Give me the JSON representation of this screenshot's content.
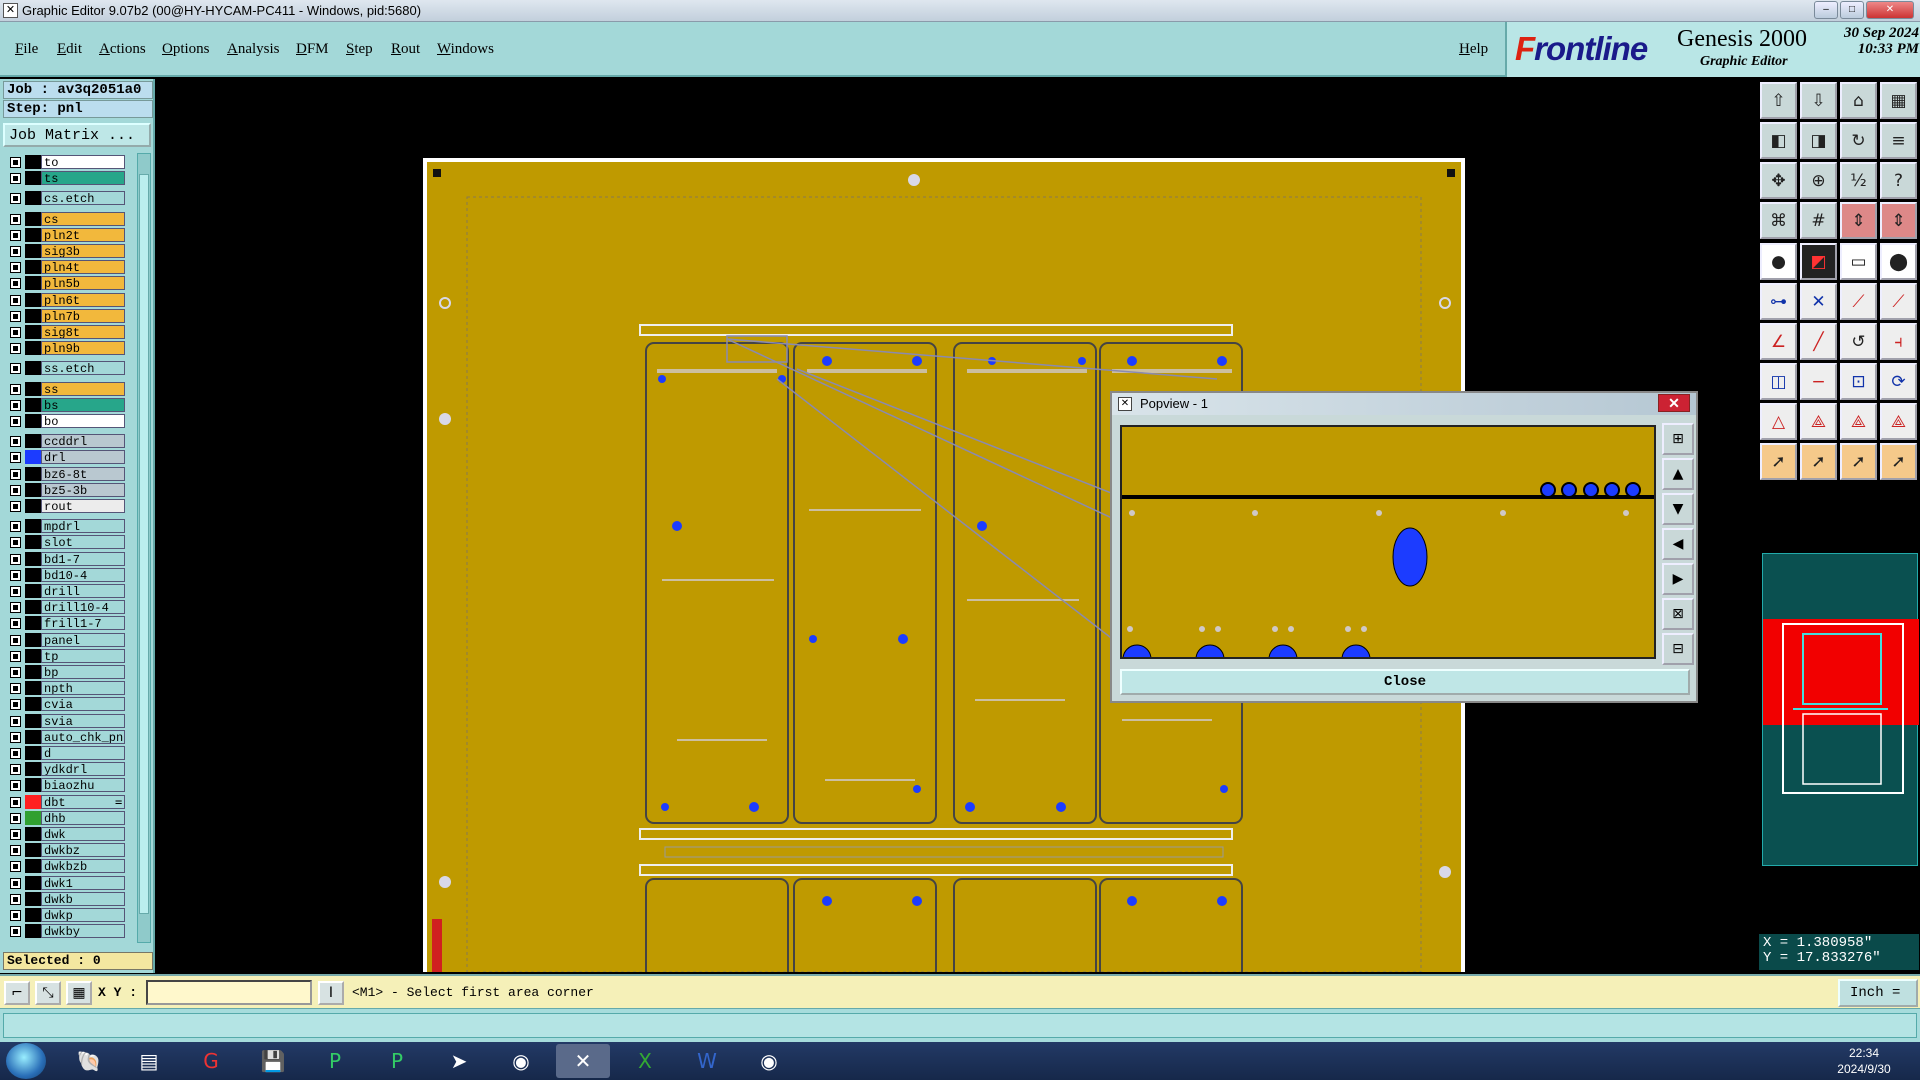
{
  "window": {
    "title": "Graphic Editor 9.07b2 (00@HY-HYCAM-PC411 - Windows, pid:5680)",
    "min": "–",
    "max": "□",
    "close": "✕"
  },
  "menu": {
    "items": [
      "File",
      "Edit",
      "Actions",
      "Options",
      "Analysis",
      "DFM",
      "Step",
      "Rout",
      "Windows"
    ],
    "help": "Help"
  },
  "brand": {
    "logo_f": "F",
    "logo_rest": "rontline",
    "product": "Genesis 2000",
    "subtitle": "Graphic Editor",
    "date": "30 Sep 2024",
    "time": "10:33 PM"
  },
  "job": {
    "job_line": "Job : av3q2051a0",
    "step_line": "Step: pnl",
    "matrix_button": "Job Matrix ..."
  },
  "layers": [
    {
      "name": "to",
      "bg": "#ffffff",
      "sw": "#000000"
    },
    {
      "name": "ts",
      "bg": "#27a68a",
      "sw": "#000000"
    },
    {
      "name": "cs.etch",
      "bg": "#a3d8d8",
      "sw": "#000000",
      "gap": true
    },
    {
      "name": "cs",
      "bg": "#f2b83c",
      "sw": "#000000",
      "gap": true
    },
    {
      "name": "pln2t",
      "bg": "#f2b83c",
      "sw": "#000000"
    },
    {
      "name": "sig3b",
      "bg": "#f2b83c",
      "sw": "#000000"
    },
    {
      "name": "pln4t",
      "bg": "#f2b83c",
      "sw": "#000000"
    },
    {
      "name": "pln5b",
      "bg": "#f2b83c",
      "sw": "#000000"
    },
    {
      "name": "pln6t",
      "bg": "#f2b83c",
      "sw": "#000000"
    },
    {
      "name": "pln7b",
      "bg": "#f2b83c",
      "sw": "#000000"
    },
    {
      "name": "sig8t",
      "bg": "#f2b83c",
      "sw": "#000000"
    },
    {
      "name": "pln9b",
      "bg": "#f2b83c",
      "sw": "#000000"
    },
    {
      "name": "ss.etch",
      "bg": "#a3d8d8",
      "sw": "#000000",
      "gap": true
    },
    {
      "name": "ss",
      "bg": "#f2b83c",
      "sw": "#000000",
      "gap": true
    },
    {
      "name": "bs",
      "bg": "#27a68a",
      "sw": "#000000"
    },
    {
      "name": "bo",
      "bg": "#ffffff",
      "sw": "#000000"
    },
    {
      "name": "ccddrl",
      "bg": "#b9c8d0",
      "sw": "#000000",
      "gap": true
    },
    {
      "name": "drl",
      "bg": "#b9c8d0",
      "sw": "#1c3cff"
    },
    {
      "name": "bz6-8t",
      "bg": "#b9c8d0",
      "sw": "#000000"
    },
    {
      "name": "bz5-3b",
      "bg": "#b9c8d0",
      "sw": "#000000"
    },
    {
      "name": "rout",
      "bg": "#ececec",
      "sw": "#000000"
    },
    {
      "name": "mpdrl",
      "bg": "#a3d8d8",
      "sw": "#000000",
      "gap": true
    },
    {
      "name": "slot",
      "bg": "#a3d8d8",
      "sw": "#000000"
    },
    {
      "name": "bd1-7",
      "bg": "#a3d8d8",
      "sw": "#000000"
    },
    {
      "name": "bd10-4",
      "bg": "#a3d8d8",
      "sw": "#000000"
    },
    {
      "name": "drill",
      "bg": "#a3d8d8",
      "sw": "#000000"
    },
    {
      "name": "drill10-4",
      "bg": "#a3d8d8",
      "sw": "#000000"
    },
    {
      "name": "frill1-7",
      "bg": "#a3d8d8",
      "sw": "#000000"
    },
    {
      "name": "panel",
      "bg": "#a3d8d8",
      "sw": "#000000"
    },
    {
      "name": "tp",
      "bg": "#a3d8d8",
      "sw": "#000000"
    },
    {
      "name": "bp",
      "bg": "#a3d8d8",
      "sw": "#000000"
    },
    {
      "name": "npth",
      "bg": "#a3d8d8",
      "sw": "#000000"
    },
    {
      "name": "cvia",
      "bg": "#a3d8d8",
      "sw": "#000000"
    },
    {
      "name": "svia",
      "bg": "#a3d8d8",
      "sw": "#000000"
    },
    {
      "name": "auto_chk_pn",
      "bg": "#a3d8d8",
      "sw": "#000000"
    },
    {
      "name": "d",
      "bg": "#a3d8d8",
      "sw": "#000000"
    },
    {
      "name": "ydkdrl",
      "bg": "#a3d8d8",
      "sw": "#000000"
    },
    {
      "name": "biaozhu",
      "bg": "#a3d8d8",
      "sw": "#000000"
    },
    {
      "name": "dbt",
      "bg": "#a3d8d8",
      "sw": "#ff2020",
      "mark": "="
    },
    {
      "name": "dhb",
      "bg": "#a3d8d8",
      "sw": "#30a030"
    },
    {
      "name": "dwk",
      "bg": "#a3d8d8",
      "sw": "#000000"
    },
    {
      "name": "dwkbz",
      "bg": "#a3d8d8",
      "sw": "#000000"
    },
    {
      "name": "dwkbzb",
      "bg": "#a3d8d8",
      "sw": "#000000"
    },
    {
      "name": "dwk1",
      "bg": "#a3d8d8",
      "sw": "#000000"
    },
    {
      "name": "dwkb",
      "bg": "#a3d8d8",
      "sw": "#000000"
    },
    {
      "name": "dwkp",
      "bg": "#a3d8d8",
      "sw": "#000000"
    },
    {
      "name": "dwkby",
      "bg": "#a3d8d8",
      "sw": "#000000"
    }
  ],
  "selected": "Selected : 0",
  "popview": {
    "title": "Popview - 1",
    "close_label": "Close"
  },
  "coords": {
    "x": "X = 1.380958\"",
    "y": "Y = 17.833276\""
  },
  "status": {
    "xy_label": "X Y :",
    "xy_value": "",
    "prompt": "<M1> - Select first area corner",
    "units": "Inch ="
  },
  "taskbar": {
    "time": "22:34",
    "date": "2024/9/30"
  },
  "colors": {
    "board": "#bf9a00",
    "pad": "#1c3cff",
    "menu_bg": "#a3d8d8"
  }
}
